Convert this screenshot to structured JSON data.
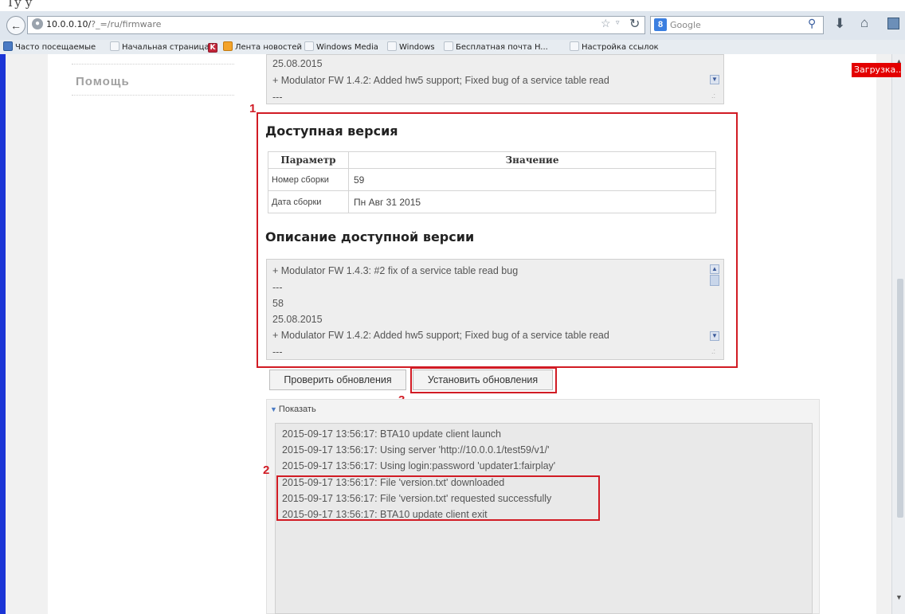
{
  "doc_fragment": "Ту                             у",
  "browser": {
    "url_host": "10.0.0.10/",
    "url_path": "?_=/ru/firmware",
    "search_engine": "Google",
    "bookmarks": [
      "Часто посещаемые",
      "Начальная страница",
      "Лента новостей",
      "Windows Media",
      "Windows",
      "Бесплатная почта H...",
      "Настройка ссылок"
    ],
    "loading_badge": "Загрузка..."
  },
  "sidebar": {
    "help_label": "Помощь"
  },
  "top_textarea": {
    "lines": [
      "25.08.2015",
      "+ Modulator FW 1.4.2: Added hw5 support; Fixed bug of a service table read",
      "---"
    ]
  },
  "available": {
    "title": "Доступная версия",
    "table": {
      "headers": [
        "Параметр",
        "Значение"
      ],
      "rows": [
        {
          "param": "Номер сборки",
          "value": "59"
        },
        {
          "param": "Дата сборки",
          "value": "Пн Авг 31 2015"
        }
      ]
    },
    "desc_title": "Описание доступной версии",
    "desc_lines": [
      "+ Modulator FW 1.4.3: #2 fix of a service table read bug",
      "---",
      "58",
      "25.08.2015",
      "+ Modulator FW 1.4.2: Added hw5 support; Fixed bug of a service table read",
      "---"
    ]
  },
  "buttons": {
    "check_updates": "Проверить обновления",
    "install_updates": "Установить обновления"
  },
  "log": {
    "toggle_label": "Показать",
    "lines": [
      "2015-09-17 13:56:17: BTA10 update client launch",
      "2015-09-17 13:56:17: Using server 'http://10.0.0.1/test59/v1/'",
      "2015-09-17 13:56:17: Using login:password 'updater1:fairplay'",
      "2015-09-17 13:56:17: File 'version.txt' downloaded",
      "2015-09-17 13:56:17: File 'version.txt' requested successfully",
      "2015-09-17 13:56:17: BTA10 update client exit"
    ]
  },
  "annotations": {
    "n1": "1",
    "n2": "2",
    "n3": "3",
    "color": "#d11b24"
  },
  "colors": {
    "page_stripe": "#1b35d6",
    "loading_badge": "#e30000"
  }
}
